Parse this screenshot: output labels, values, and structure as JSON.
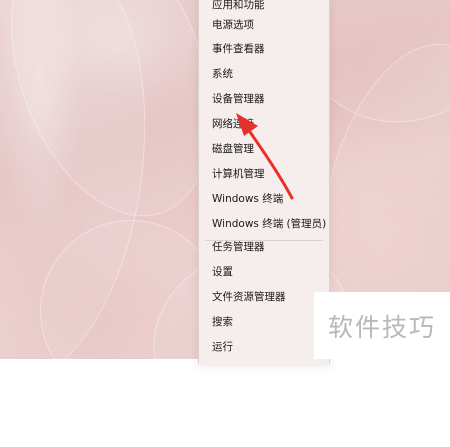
{
  "menu": {
    "items": [
      {
        "label": "应用和功能"
      },
      {
        "label": "电源选项"
      },
      {
        "label": "事件查看器"
      },
      {
        "label": "系统"
      },
      {
        "label": "设备管理器"
      },
      {
        "label": "网络连接"
      },
      {
        "label": "磁盘管理"
      },
      {
        "label": "计算机管理"
      },
      {
        "label": "Windows 终端"
      },
      {
        "label": "Windows 终端 (管理员)"
      },
      {
        "label": "任务管理器"
      },
      {
        "label": "设置"
      },
      {
        "label": "文件资源管理器"
      },
      {
        "label": "搜索"
      },
      {
        "label": "运行"
      }
    ]
  },
  "annotation": {
    "arrow_color": "#e8302a",
    "target": "网络连接"
  },
  "watermark": {
    "text": "软件技巧"
  },
  "colors": {
    "menu_background": "#f6eded",
    "wallpaper": "#e6c5c5",
    "text": "#1a1a1a"
  }
}
